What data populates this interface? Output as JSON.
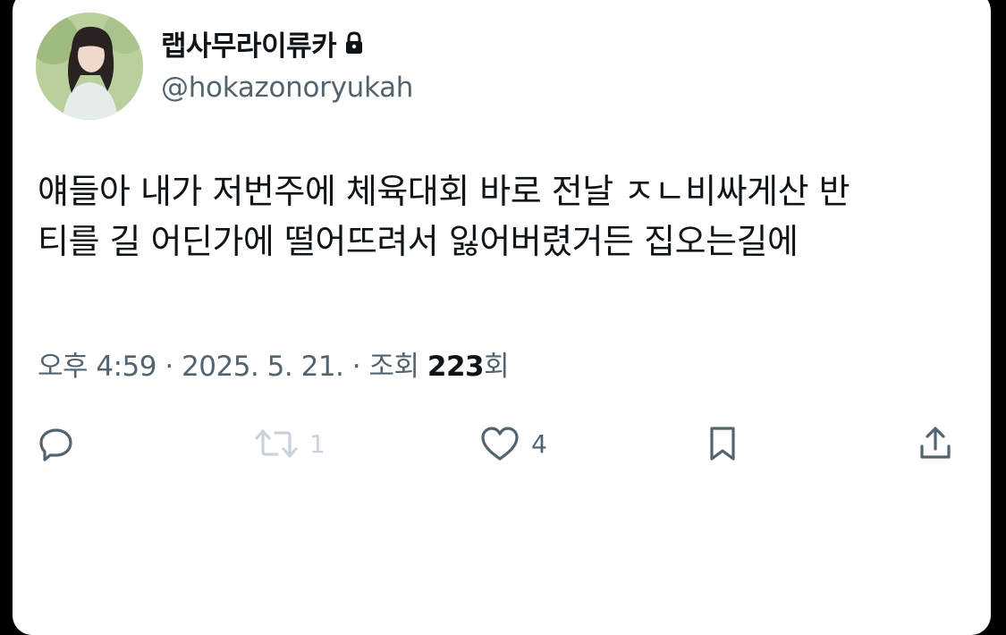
{
  "colors": {
    "text_primary": "#0f1419",
    "text_secondary": "#536471",
    "background": "#ffffff",
    "outer_background": "#000000",
    "faded_icon": "#c9d3dc"
  },
  "author": {
    "display_name": "랩사무라이류카",
    "handle": "@hokazonoryukah",
    "protected_icon": "lock-icon",
    "avatar_icon": "avatar"
  },
  "tweet": {
    "lines": [
      "얘들아 내가 저번주에 체육대회 바로 전날 ㅈㄴ비싸게산 반",
      "티를 길 어딘가에 떨어뜨려서 잃어버렸거든 집오는길에"
    ]
  },
  "meta": {
    "time": "오후 4:59",
    "separator": " · ",
    "date": "2025. 5. 21.",
    "views_prefix": "조회 ",
    "views_count": "223",
    "views_suffix": "회"
  },
  "actions": {
    "reply": {
      "icon": "reply-icon",
      "count": ""
    },
    "retweet": {
      "icon": "retweet-icon",
      "count": "1"
    },
    "like": {
      "icon": "heart-icon",
      "count": "4"
    },
    "bookmark": {
      "icon": "bookmark-icon",
      "count": ""
    },
    "share": {
      "icon": "share-icon",
      "count": ""
    }
  }
}
